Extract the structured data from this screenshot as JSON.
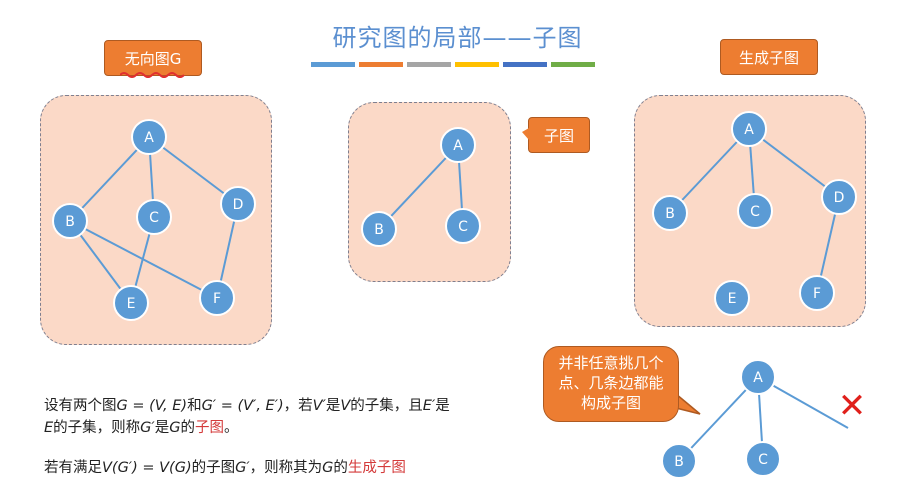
{
  "title": "研究图的局部——子图",
  "stripes": [
    {
      "color": "#5b9bd5"
    },
    {
      "color": "#ed7d31"
    },
    {
      "color": "#a5a5a5"
    },
    {
      "color": "#ffc000"
    },
    {
      "color": "#4472c4"
    },
    {
      "color": "#70ad47"
    }
  ],
  "labels": {
    "undirected": "无向图G",
    "subgraph": "子图",
    "spanning": "生成子图",
    "warning": "并非任意挑几个点、几条边都能构成子图"
  },
  "colors": {
    "node_fill": "#5b9bd5",
    "node_stroke": "#ffffff",
    "edge": "#5b9bd5",
    "callout": "#ed7d31",
    "panel": "#fbd9c7",
    "highlight": "#d43b3b"
  },
  "graphs": {
    "g": {
      "nodes": [
        "A",
        "B",
        "C",
        "D",
        "E",
        "F"
      ],
      "edges": [
        [
          "A",
          "B"
        ],
        [
          "A",
          "C"
        ],
        [
          "A",
          "D"
        ],
        [
          "B",
          "E"
        ],
        [
          "B",
          "F"
        ],
        [
          "C",
          "E"
        ],
        [
          "D",
          "F"
        ]
      ]
    },
    "sub": {
      "nodes": [
        "A",
        "B",
        "C"
      ],
      "edges": [
        [
          "A",
          "B"
        ],
        [
          "A",
          "C"
        ]
      ]
    },
    "spanning": {
      "nodes": [
        "A",
        "B",
        "C",
        "D",
        "E",
        "F"
      ],
      "edges": [
        [
          "A",
          "B"
        ],
        [
          "A",
          "C"
        ],
        [
          "A",
          "D"
        ],
        [
          "D",
          "F"
        ]
      ]
    },
    "invalid": {
      "nodes": [
        "A",
        "B",
        "C"
      ],
      "edges": [
        [
          "A",
          "B"
        ],
        [
          "A",
          "C"
        ]
      ],
      "dangling_from": "A",
      "mark": "✕"
    }
  },
  "text": {
    "p1_a": "设有两个图",
    "p1_math1": "G = (V, E)",
    "p1_and": "和",
    "p1_math2": "G′ = (V′, E′)",
    "p1_b": "，若",
    "p1_v1": "V′",
    "p1_c": "是",
    "p1_v2": "V",
    "p1_d": "的子集，且",
    "p1_e1": "E′",
    "p1_e": "是",
    "p1_e2": "E",
    "p1_f": "的子集，则称",
    "p1_g1": "G′",
    "p1_g": "是",
    "p1_g2": "G",
    "p1_h": "的",
    "p1_red": "子图",
    "p1_end": "。",
    "p2_a": "若有满足",
    "p2_math": "V(G′) = V(G)",
    "p2_b": "的子图",
    "p2_g1": "G′",
    "p2_c": "，则称其为",
    "p2_g2": "G",
    "p2_d": "的",
    "p2_red": "生成子图"
  }
}
